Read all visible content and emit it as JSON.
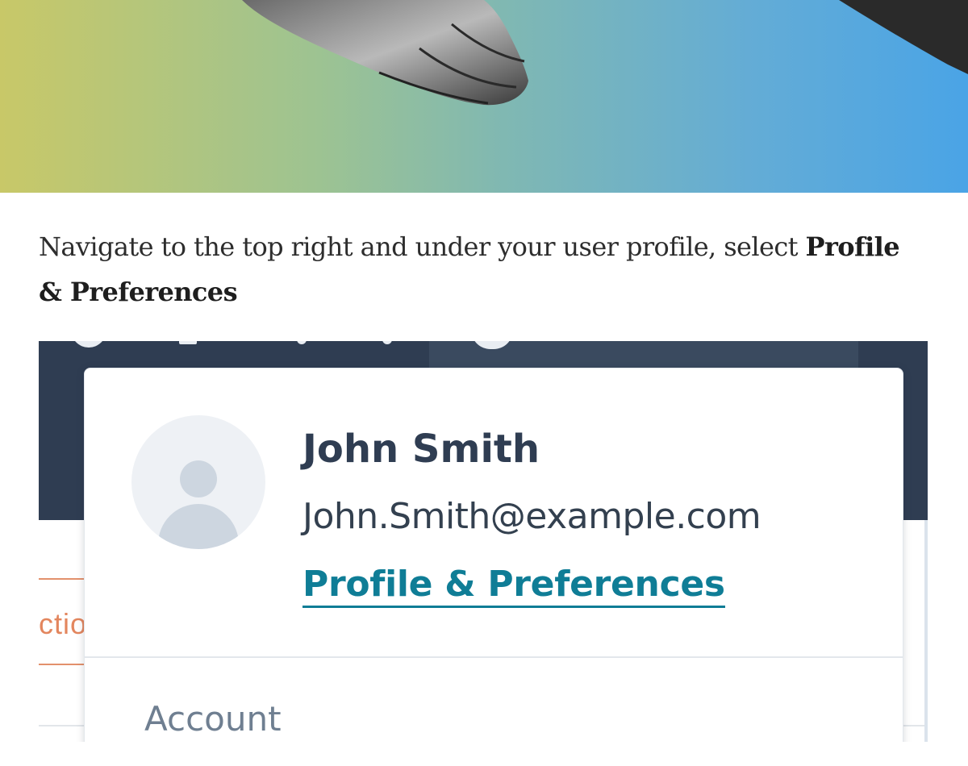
{
  "instruction": {
    "text_before": "Navigate to the top right and under your user profile, select ",
    "bold_text": "Profile & Preferences"
  },
  "profile_menu": {
    "user_name": "John Smith",
    "user_email": "John.Smith@example.com",
    "profile_link": "Profile & Preferences",
    "section_label": "Account"
  },
  "background_app": {
    "peek_text": "ctio"
  },
  "colors": {
    "nav_background": "#2f3d52",
    "link_color": "#0f7d96",
    "hero_gradient_start": "#c8c868",
    "hero_gradient_end": "#4aa4e6"
  }
}
